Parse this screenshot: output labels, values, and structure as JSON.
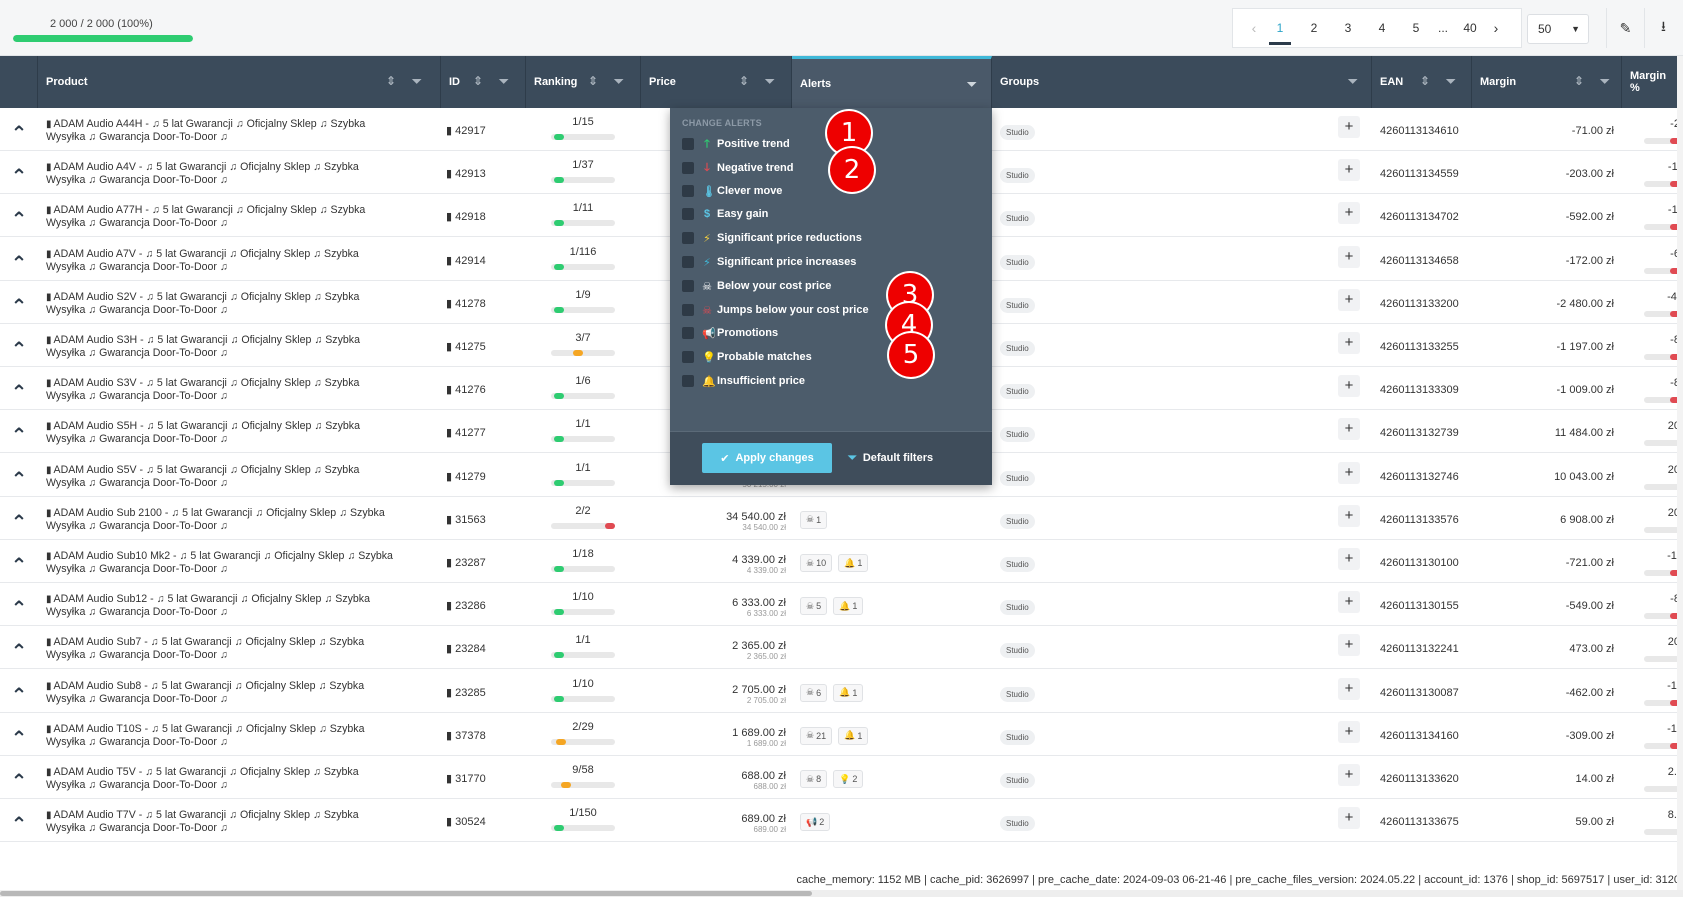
{
  "progress": {
    "text": "2 000 / 2 000 (100%)",
    "fraction": 1.0
  },
  "pagination": {
    "prev": "‹",
    "pages": [
      "1",
      "2",
      "3",
      "4",
      "5",
      "...",
      "40"
    ],
    "active": "1",
    "next": "›"
  },
  "per_page": "50",
  "columns": {
    "product": "Product",
    "id": "ID",
    "ranking": "Ranking",
    "price": "Price",
    "alerts": "Alerts",
    "groups": "Groups",
    "ean": "EAN",
    "margin": "Margin",
    "margin_pct": "Margin %"
  },
  "alerts_dropdown": {
    "title": "CHANGE ALERTS",
    "items": [
      {
        "label": "Positive trend",
        "icon": "arrow-up-icon",
        "glyph": "🡑",
        "color": "#2ecc71"
      },
      {
        "label": "Negative trend",
        "icon": "arrow-down-icon",
        "glyph": "🡓",
        "color": "#e04a52"
      },
      {
        "label": "Clever move",
        "icon": "thermometer-icon",
        "glyph": "🌡",
        "color": "#5bc5e4"
      },
      {
        "label": "Easy gain",
        "icon": "dollar-icon",
        "glyph": "$",
        "color": "#5bc5e4"
      },
      {
        "label": "Significant price reductions",
        "icon": "bolt-down-icon",
        "glyph": "⚡",
        "color": "#f4d03f"
      },
      {
        "label": "Significant price increases",
        "icon": "bolt-up-icon",
        "glyph": "⚡",
        "color": "#3fb8d8"
      },
      {
        "label": "Below your cost price",
        "icon": "skull-icon",
        "glyph": "☠",
        "color": "#ffffff"
      },
      {
        "label": "Jumps below your cost price",
        "icon": "skull-jump-icon",
        "glyph": "☠",
        "color": "#e04a52"
      },
      {
        "label": "Promotions",
        "icon": "megaphone-icon",
        "glyph": "📢",
        "color": "#2ecc71"
      },
      {
        "label": "Probable matches",
        "icon": "lightbulb-icon",
        "glyph": "💡",
        "color": "#c5e04a"
      },
      {
        "label": "Insufficient price",
        "icon": "bell-icon",
        "glyph": "🔔",
        "color": "#f07c1e"
      }
    ],
    "apply_label": "Apply changes",
    "default_label": "Default filters"
  },
  "markers": [
    "1",
    "2",
    "3",
    "4",
    "5"
  ],
  "rows": [
    {
      "line1": "ADAM Audio A44H - ♫ 5 lat Gwarancji ♫ Oficjalny Sklep ♫ Szybka",
      "line2": "Wysyłka ♫ Gwarancja Door-To-Door ♫",
      "id": "42917",
      "rank": "1/15",
      "rank_level": 0.05,
      "rank_color": "#2ecc71",
      "price": "",
      "price_sub": "",
      "alerts": [],
      "group": "Studio",
      "ean": "4260113134610",
      "margin": "-71.00 zł",
      "margin_pct": "-2.",
      "mneg": true
    },
    {
      "line1": "ADAM Audio A4V - ♫ 5 lat Gwarancji ♫ Oficjalny Sklep ♫ Szybka",
      "line2": "Wysyłka ♫ Gwarancja Door-To-Door ♫",
      "id": "42913",
      "rank": "1/37",
      "rank_level": 0.05,
      "rank_color": "#2ecc71",
      "price": "",
      "price_sub": "",
      "alerts": [],
      "group": "Studio",
      "ean": "4260113134559",
      "margin": "-203.00 zł",
      "margin_pct": "-11",
      "mneg": true
    },
    {
      "line1": "ADAM Audio A77H - ♫ 5 lat Gwarancji ♫ Oficjalny Sklep ♫ Szybka",
      "line2": "Wysyłka ♫ Gwarancja Door-To-Door ♫",
      "id": "42918",
      "rank": "1/11",
      "rank_level": 0.05,
      "rank_color": "#2ecc71",
      "price": "",
      "price_sub": "",
      "alerts": [],
      "group": "Studio",
      "ean": "4260113134702",
      "margin": "-592.00 zł",
      "margin_pct": "-11",
      "mneg": true
    },
    {
      "line1": "ADAM Audio A7V - ♫ 5 lat Gwarancji ♫ Oficjalny Sklep ♫ Szybka",
      "line2": "Wysyłka ♫ Gwarancja Door-To-Door ♫",
      "id": "42914",
      "rank": "1/116",
      "rank_level": 0.05,
      "rank_color": "#2ecc71",
      "price": "",
      "price_sub": "",
      "alerts": [],
      "group": "Studio",
      "ean": "4260113134658",
      "margin": "-172.00 zł",
      "margin_pct": "-6.",
      "mneg": true
    },
    {
      "line1": "ADAM Audio S2V - ♫ 5 lat Gwarancji ♫ Oficjalny Sklep ♫ Szybka",
      "line2": "Wysyłka ♫ Gwarancja Door-To-Door ♫",
      "id": "41278",
      "rank": "1/9",
      "rank_level": 0.05,
      "rank_color": "#2ecc71",
      "price": "",
      "price_sub": "",
      "alerts": [],
      "group": "Studio",
      "ean": "4260113133200",
      "margin": "-2 480.00 zł",
      "margin_pct": "-40",
      "mneg": true
    },
    {
      "line1": "ADAM Audio S3H - ♫ 5 lat Gwarancji ♫ Oficjalny Sklep ♫ Szybka",
      "line2": "Wysyłka ♫ Gwarancja Door-To-Door ♫",
      "id": "41275",
      "rank": "3/7",
      "rank_level": 0.35,
      "rank_color": "#f5a623",
      "price": "",
      "price_sub": "",
      "alerts": [],
      "group": "Studio",
      "ean": "4260113133255",
      "margin": "-1 197.00 zł",
      "margin_pct": "-8.",
      "mneg": true
    },
    {
      "line1": "ADAM Audio S3V - ♫ 5 lat Gwarancji ♫ Oficjalny Sklep ♫ Szybka",
      "line2": "Wysyłka ♫ Gwarancja Door-To-Door ♫",
      "id": "41276",
      "rank": "1/6",
      "rank_level": 0.05,
      "rank_color": "#2ecc71",
      "price": "",
      "price_sub": "",
      "alerts": [],
      "group": "Studio",
      "ean": "4260113133309",
      "margin": "-1 009.00 zł",
      "margin_pct": "-8.",
      "mneg": true
    },
    {
      "line1": "ADAM Audio S5H - ♫ 5 lat Gwarancji ♫ Oficjalny Sklep ♫ Szybka",
      "line2": "Wysyłka ♫ Gwarancja Door-To-Door ♫",
      "id": "41277",
      "rank": "1/1",
      "rank_level": 0.05,
      "rank_color": "#2ecc71",
      "price": "",
      "price_sub": "",
      "alerts": [],
      "group": "Studio",
      "ean": "4260113132739",
      "margin": "11 484.00 zł",
      "margin_pct": "20.",
      "mneg": false
    },
    {
      "line1": "ADAM Audio S5V - ♫ 5 lat Gwarancji ♫ Oficjalny Sklep ♫ Szybka",
      "line2": "Wysyłka ♫ Gwarancja Door-To-Door ♫",
      "id": "41279",
      "rank": "1/1",
      "rank_level": 0.05,
      "rank_color": "#2ecc71",
      "price": "50 215.00 zł",
      "price_sub": "50 215.00 zł",
      "alerts": [],
      "group": "Studio",
      "ean": "4260113132746",
      "margin": "10 043.00 zł",
      "margin_pct": "20.",
      "mneg": false
    },
    {
      "line1": "ADAM Audio Sub 2100 - ♫ 5 lat Gwarancji ♫ Oficjalny Sklep ♫ Szybka",
      "line2": "Wysyłka ♫ Gwarancja Door-To-Door ♫",
      "id": "31563",
      "rank": "2/2",
      "rank_level": 0.95,
      "rank_color": "#e04a52",
      "price": "34 540.00 zł",
      "price_sub": "34 540.00 zł",
      "alerts": [
        {
          "icon": "skull-icon",
          "glyph": "☠",
          "count": "1",
          "color": "#555555"
        }
      ],
      "group": "Studio",
      "ean": "4260113133576",
      "margin": "6 908.00 zł",
      "margin_pct": "20.",
      "mneg": false
    },
    {
      "line1": "ADAM Audio Sub10 Mk2 - ♫ 5 lat Gwarancji ♫ Oficjalny Sklep ♫ Szybka",
      "line2": "Wysyłka ♫ Gwarancja Door-To-Door ♫",
      "id": "23287",
      "rank": "1/18",
      "rank_level": 0.05,
      "rank_color": "#2ecc71",
      "price": "4 339.00 zł",
      "price_sub": "4 339.00 zł",
      "alerts": [
        {
          "icon": "skull-icon",
          "glyph": "☠",
          "count": "10",
          "color": "#555555"
        },
        {
          "icon": "bell-icon",
          "glyph": "🔔",
          "count": "1",
          "color": "#f07c1e"
        }
      ],
      "group": "Studio",
      "ean": "4260113130100",
      "margin": "-721.00 zł",
      "margin_pct": "-16",
      "mneg": true
    },
    {
      "line1": "ADAM Audio Sub12 - ♫ 5 lat Gwarancji ♫ Oficjalny Sklep ♫ Szybka",
      "line2": "Wysyłka ♫ Gwarancja Door-To-Door ♫",
      "id": "23286",
      "rank": "1/10",
      "rank_level": 0.05,
      "rank_color": "#2ecc71",
      "price": "6 333.00 zł",
      "price_sub": "6 333.00 zł",
      "alerts": [
        {
          "icon": "skull-icon",
          "glyph": "☠",
          "count": "5",
          "color": "#555555"
        },
        {
          "icon": "bell-icon",
          "glyph": "🔔",
          "count": "1",
          "color": "#f07c1e"
        }
      ],
      "group": "Studio",
      "ean": "4260113130155",
      "margin": "-549.00 zł",
      "margin_pct": "-8.",
      "mneg": true
    },
    {
      "line1": "ADAM Audio Sub7 - ♫ 5 lat Gwarancji ♫ Oficjalny Sklep ♫ Szybka",
      "line2": "Wysyłka ♫ Gwarancja Door-To-Door ♫",
      "id": "23284",
      "rank": "1/1",
      "rank_level": 0.05,
      "rank_color": "#2ecc71",
      "price": "2 365.00 zł",
      "price_sub": "2 365.00 zł",
      "alerts": [],
      "group": "Studio",
      "ean": "4260113132241",
      "margin": "473.00 zł",
      "margin_pct": "20.",
      "mneg": false
    },
    {
      "line1": "ADAM Audio Sub8 - ♫ 5 lat Gwarancji ♫ Oficjalny Sklep ♫ Szybka",
      "line2": "Wysyłka ♫ Gwarancja Door-To-Door ♫",
      "id": "23285",
      "rank": "1/10",
      "rank_level": 0.05,
      "rank_color": "#2ecc71",
      "price": "2 705.00 zł",
      "price_sub": "2 705.00 zł",
      "alerts": [
        {
          "icon": "skull-icon",
          "glyph": "☠",
          "count": "6",
          "color": "#555555"
        },
        {
          "icon": "bell-icon",
          "glyph": "🔔",
          "count": "1",
          "color": "#f07c1e"
        }
      ],
      "group": "Studio",
      "ean": "4260113130087",
      "margin": "-462.00 zł",
      "margin_pct": "-17",
      "mneg": true
    },
    {
      "line1": "ADAM Audio T10S - ♫ 5 lat Gwarancji ♫ Oficjalny Sklep ♫ Szybka",
      "line2": "Wysyłka ♫ Gwarancja Door-To-Door ♫",
      "id": "37378",
      "rank": "2/29",
      "rank_level": 0.08,
      "rank_color": "#f5a623",
      "price": "1 689.00 zł",
      "price_sub": "1 689.00 zł",
      "alerts": [
        {
          "icon": "skull-icon",
          "glyph": "☠",
          "count": "21",
          "color": "#555555"
        },
        {
          "icon": "bell-icon",
          "glyph": "🔔",
          "count": "1",
          "color": "#f07c1e"
        }
      ],
      "group": "Studio",
      "ean": "4260113134160",
      "margin": "-309.00 zł",
      "margin_pct": "-18",
      "mneg": true
    },
    {
      "line1": "ADAM Audio T5V - ♫ 5 lat Gwarancji ♫ Oficjalny Sklep ♫ Szybka",
      "line2": "Wysyłka ♫ Gwarancja Door-To-Door ♫",
      "id": "31770",
      "rank": "9/58",
      "rank_level": 0.16,
      "rank_color": "#f5a623",
      "price": "688.00 zł",
      "price_sub": "688.00 zł",
      "alerts": [
        {
          "icon": "skull-icon",
          "glyph": "☠",
          "count": "8",
          "color": "#555555"
        },
        {
          "icon": "lightbulb-icon",
          "glyph": "💡",
          "count": "2",
          "color": "#9ccc2a"
        }
      ],
      "group": "Studio",
      "ean": "4260113133620",
      "margin": "14.00 zł",
      "margin_pct": "2.0",
      "mneg": false
    },
    {
      "line1": "ADAM Audio T7V - ♫ 5 lat Gwarancji ♫ Oficjalny Sklep ♫ Szybka",
      "line2": "Wysyłka ♫ Gwarancja Door-To-Door ♫",
      "id": "30524",
      "rank": "1/150",
      "rank_level": 0.05,
      "rank_color": "#2ecc71",
      "price": "689.00 zł",
      "price_sub": "689.00 zł",
      "alerts": [
        {
          "icon": "megaphone-icon",
          "glyph": "📢",
          "count": "2",
          "color": "#2ecc71"
        }
      ],
      "group": "Studio",
      "ean": "4260113133675",
      "margin": "59.00 zł",
      "margin_pct": "8.5",
      "mneg": false
    }
  ],
  "footer_info": "cache_memory: 1152 MB | cache_pid: 3626997 | pre_cache_date: 2024-09-03 06-21-46 | pre_cache_files_version: 2024.05.22 | account_id: 1376 | shop_id: 5697517 | user_id: 3120"
}
